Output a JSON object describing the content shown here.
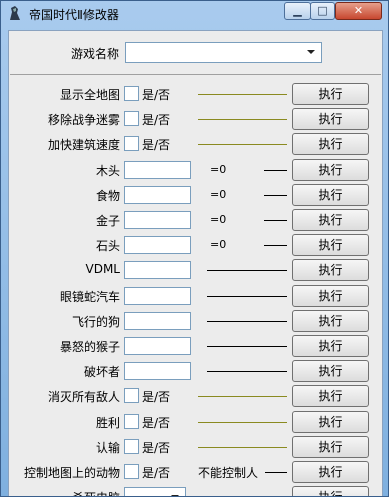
{
  "window": {
    "title": "帝国时代Ⅱ修改器",
    "buttons": {
      "minimize": "▁",
      "maximize": "□",
      "close": "✕"
    }
  },
  "game_select": {
    "label": "游戏名称",
    "value": ""
  },
  "execute_label": "执行",
  "checkbox_suffix": "是/否",
  "rows": [
    {
      "label": "显示全地图",
      "type": "checkbox"
    },
    {
      "label": "移除战争迷雾",
      "type": "checkbox"
    },
    {
      "label": "加快建筑速度",
      "type": "checkbox"
    },
    {
      "label": "木头",
      "type": "resource",
      "eq": "=0"
    },
    {
      "label": "食物",
      "type": "resource",
      "eq": "=0"
    },
    {
      "label": "金子",
      "type": "resource",
      "eq": "=0"
    },
    {
      "label": "石头",
      "type": "resource",
      "eq": "=0"
    },
    {
      "label": "VDML",
      "type": "unit"
    },
    {
      "label": "眼镜蛇汽车",
      "type": "unit"
    },
    {
      "label": "飞行的狗",
      "type": "unit"
    },
    {
      "label": "暴怒的猴子",
      "type": "unit"
    },
    {
      "label": "破坏者",
      "type": "unit"
    },
    {
      "label": "消灭所有敌人",
      "type": "checkbox"
    },
    {
      "label": "胜利",
      "type": "checkbox"
    },
    {
      "label": "认输",
      "type": "checkbox"
    },
    {
      "label": "控制地图上的动物",
      "type": "checkbox",
      "note": "不能控制人"
    },
    {
      "label": "杀死电脑",
      "type": "select"
    }
  ]
}
